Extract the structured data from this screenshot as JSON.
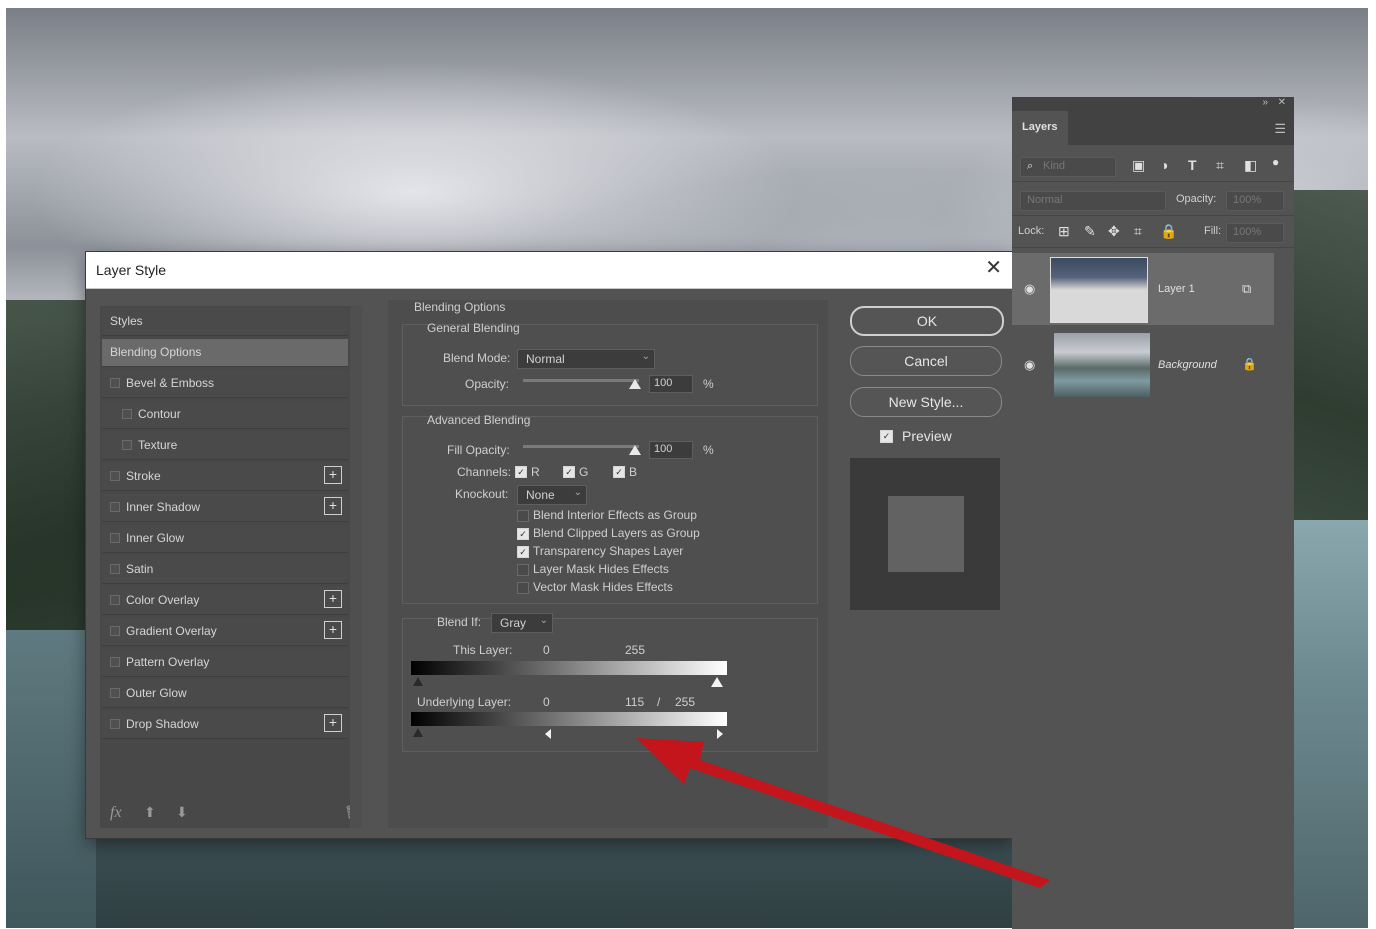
{
  "dialog": {
    "title": "Layer Style",
    "close_glyph": "✕",
    "styles_header": "Styles",
    "styles": [
      {
        "label": "Blending Options",
        "checkbox": false,
        "plus": false,
        "active": true
      },
      {
        "label": "Bevel & Emboss",
        "checkbox": true,
        "plus": false
      },
      {
        "label": "Contour",
        "checkbox": true,
        "plus": false,
        "indent": true
      },
      {
        "label": "Texture",
        "checkbox": true,
        "plus": false,
        "indent": true
      },
      {
        "label": "Stroke",
        "checkbox": true,
        "plus": true
      },
      {
        "label": "Inner Shadow",
        "checkbox": true,
        "plus": true
      },
      {
        "label": "Inner Glow",
        "checkbox": true,
        "plus": false
      },
      {
        "label": "Satin",
        "checkbox": true,
        "plus": false
      },
      {
        "label": "Color Overlay",
        "checkbox": true,
        "plus": true
      },
      {
        "label": "Gradient Overlay",
        "checkbox": true,
        "plus": true
      },
      {
        "label": "Pattern Overlay",
        "checkbox": true,
        "plus": false
      },
      {
        "label": "Outer Glow",
        "checkbox": true,
        "plus": false
      },
      {
        "label": "Drop Shadow",
        "checkbox": true,
        "plus": true
      }
    ],
    "footer": {
      "fx": "fx",
      "up": "⬆",
      "down": "⬇",
      "trash": "🗑"
    },
    "blending": {
      "section_title": "Blending Options",
      "general_title": "General Blending",
      "blend_mode_label": "Blend Mode:",
      "blend_mode_value": "Normal",
      "opacity_label": "Opacity:",
      "opacity_value": "100",
      "opacity_unit": "%",
      "advanced_title": "Advanced Blending",
      "fill_opacity_label": "Fill Opacity:",
      "fill_opacity_value": "100",
      "fill_opacity_unit": "%",
      "channels_label": "Channels:",
      "channel_r": "R",
      "channel_g": "G",
      "channel_b": "B",
      "knockout_label": "Knockout:",
      "knockout_value": "None",
      "options": [
        {
          "label": "Blend Interior Effects as Group",
          "checked": false
        },
        {
          "label": "Blend Clipped Layers as Group",
          "checked": true
        },
        {
          "label": "Transparency Shapes Layer",
          "checked": true
        },
        {
          "label": "Layer Mask Hides Effects",
          "checked": false
        },
        {
          "label": "Vector Mask Hides Effects",
          "checked": false
        }
      ],
      "blend_if_label": "Blend If:",
      "blend_if_value": "Gray",
      "this_layer_label": "This Layer:",
      "this_layer_min": "0",
      "this_layer_max": "255",
      "underlying_label": "Underlying Layer:",
      "underlying_min": "0",
      "underlying_split": "115",
      "underlying_slash": "/",
      "underlying_max": "255"
    },
    "buttons": {
      "ok": "OK",
      "cancel": "Cancel",
      "new_style": "New Style...",
      "preview": "Preview"
    }
  },
  "layers_panel": {
    "tab": "Layers",
    "kind_placeholder": "Kind",
    "blend_mode": "Normal",
    "opacity_label": "Opacity:",
    "opacity_value": "100%",
    "lock_label": "Lock:",
    "fill_label": "Fill:",
    "fill_value": "100%",
    "layers": [
      {
        "name": "Layer 1",
        "selected": true
      },
      {
        "name": "Background",
        "selected": false
      }
    ]
  },
  "colors": {
    "dialog_bg": "#535353",
    "arrow": "#c4141c"
  }
}
